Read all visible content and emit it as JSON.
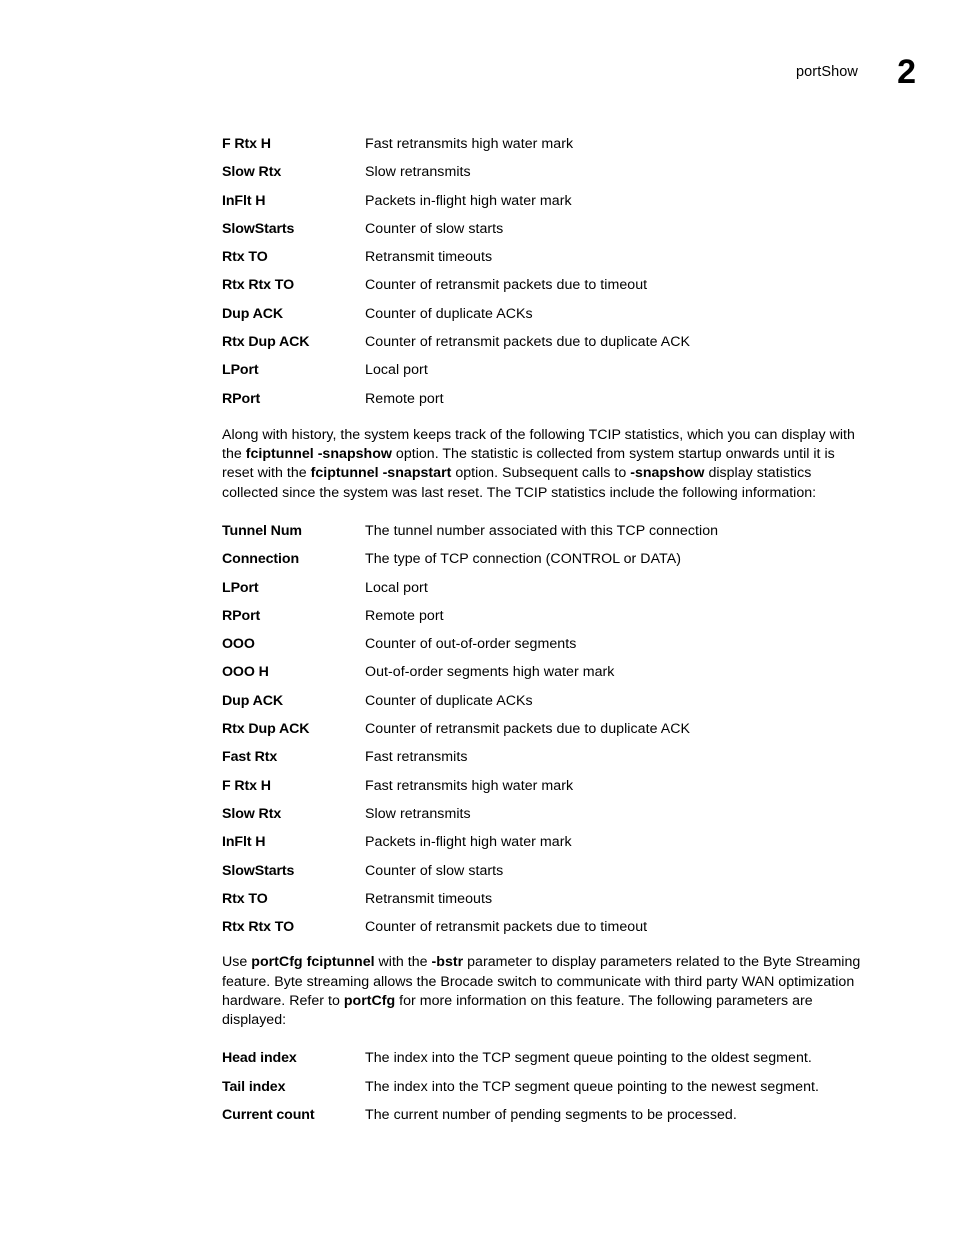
{
  "header": {
    "title": "portShow",
    "chapter_number": "2"
  },
  "list_1": {
    "rows": [
      {
        "term": "F Rtx H",
        "desc": "Fast retransmits high water mark"
      },
      {
        "term": "Slow Rtx",
        "desc": "Slow retransmits"
      },
      {
        "term": "InFlt H",
        "desc": "Packets in-flight high water mark"
      },
      {
        "term": "SlowStarts",
        "desc": "Counter of slow starts"
      },
      {
        "term": "Rtx TO",
        "desc": "Retransmit timeouts"
      },
      {
        "term": "Rtx Rtx TO",
        "desc": "Counter of retransmit packets due to timeout"
      },
      {
        "term": "Dup ACK",
        "desc": "Counter of duplicate ACKs"
      },
      {
        "term": "Rtx Dup ACK",
        "desc": "Counter of retransmit packets due to duplicate ACK"
      },
      {
        "term": "LPort",
        "desc": "Local port"
      },
      {
        "term": "RPort",
        "desc": "Remote port"
      }
    ]
  },
  "paragraph_1": {
    "seg_1": "Along with history, the system keeps track of the following TCIP statistics, which you can display with the ",
    "bold_1": "fciptunnel -snapshow",
    "seg_2": " option. The statistic is collected from system startup onwards until it is reset with the ",
    "bold_2": "fciptunnel -snapstart",
    "seg_3": " option. Subsequent calls to ",
    "bold_3": "-snapshow",
    "seg_4": " display statistics collected since the system was last reset. The TCIP statistics include the following information:"
  },
  "list_2": {
    "rows": [
      {
        "term": "Tunnel Num",
        "desc": "The tunnel number associated with this TCP connection"
      },
      {
        "term": "Connection",
        "desc": "The type of TCP connection (CONTROL or DATA)"
      },
      {
        "term": "LPort",
        "desc": "Local port"
      },
      {
        "term": "RPort",
        "desc": "Remote port"
      },
      {
        "term": "OOO",
        "desc": "Counter of out-of-order segments"
      },
      {
        "term": "OOO H",
        "desc": "Out-of-order segments high water mark"
      },
      {
        "term": "Dup ACK",
        "desc": "Counter of duplicate ACKs"
      },
      {
        "term": "Rtx Dup ACK",
        "desc": "Counter of retransmit packets due to duplicate ACK"
      },
      {
        "term": "Fast Rtx",
        "desc": "Fast retransmits"
      },
      {
        "term": "F Rtx H",
        "desc": "Fast retransmits high water mark"
      },
      {
        "term": "Slow Rtx",
        "desc": "Slow retransmits"
      },
      {
        "term": "InFlt H",
        "desc": "Packets in-flight high water mark"
      },
      {
        "term": "SlowStarts",
        "desc": "Counter of slow starts"
      },
      {
        "term": "Rtx TO",
        "desc": "Retransmit timeouts"
      },
      {
        "term": "Rtx Rtx TO",
        "desc": "Counter of retransmit packets due to timeout"
      }
    ]
  },
  "paragraph_2": {
    "seg_1": "Use ",
    "bold_1": "portCfg fciptunnel",
    "seg_2": " with the ",
    "bold_2": "-bstr",
    "seg_3": " parameter to display parameters related to the Byte Streaming feature. Byte streaming allows the Brocade switch to communicate with third party WAN optimization hardware. Refer to ",
    "bold_3": "portCfg",
    "seg_4": " for more information on this feature. The following parameters are displayed:"
  },
  "list_3": {
    "rows": [
      {
        "term": "Head index",
        "desc": "The index into the TCP segment queue pointing to the oldest segment."
      },
      {
        "term": "Tail index",
        "desc": "The index into the TCP segment queue pointing to the newest segment."
      },
      {
        "term": "Current count",
        "desc": "The current number of pending segments to be processed."
      }
    ]
  }
}
